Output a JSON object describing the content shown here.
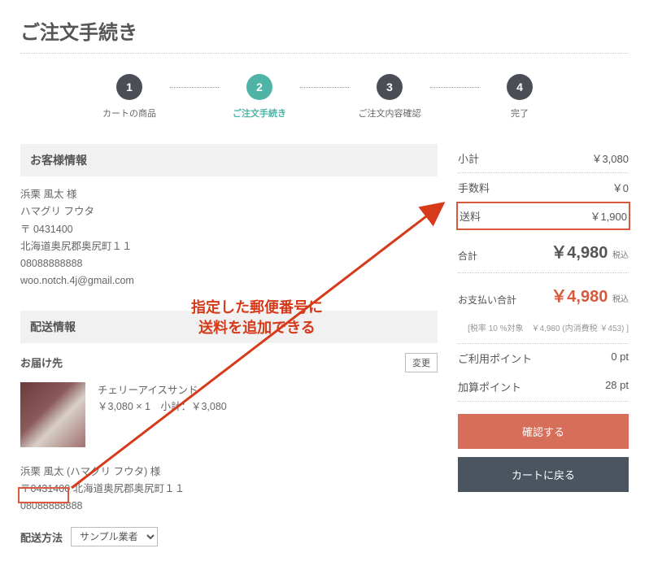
{
  "page": {
    "title": "ご注文手続き"
  },
  "steps": [
    {
      "num": "1",
      "label": "カートの商品"
    },
    {
      "num": "2",
      "label": "ご注文手続き"
    },
    {
      "num": "3",
      "label": "ご注文内容確認"
    },
    {
      "num": "4",
      "label": "完了"
    }
  ],
  "customer": {
    "header": "お客様情報",
    "name": "浜栗 風太 様",
    "kana": "ハマグリ フウタ",
    "postal": "〒 0431400",
    "address": "北海道奥尻郡奥尻町１１",
    "tel": "08088888888",
    "email": "woo.notch.4j@gmail.com"
  },
  "shipping": {
    "header": "配送情報",
    "subhead": "お届け先",
    "change_label": "変更",
    "product": {
      "name": "チェリーアイスサンド",
      "price_line": "￥3,080 × 1　小計：￥3,080"
    },
    "to": {
      "name": "浜栗 風太 (ハマグリ フウタ) 様",
      "postal_addr": "〒0431400 北海道奥尻郡奥尻町１１",
      "tel": "08088888888"
    },
    "method_label": "配送方法",
    "method_selected": "サンプル業者"
  },
  "summary": {
    "subtotal_label": "小計",
    "subtotal_value": "￥3,080",
    "fee_label": "手数料",
    "fee_value": "￥0",
    "ship_label": "送料",
    "ship_value": "￥1,900",
    "total_label": "合計",
    "total_value": "￥4,980",
    "suffix": "税込",
    "pay_label": "お支払い合計",
    "pay_value": "￥4,980",
    "tax_note": "[税率 10 %対象　￥4,980 (内消費税 ￥453) ]",
    "use_point_label": "ご利用ポイント",
    "use_point_value": "0 pt",
    "add_point_label": "加算ポイント",
    "add_point_value": "28 pt",
    "confirm_btn": "確認する",
    "back_btn": "カートに戻る"
  },
  "annotation": {
    "line1": "指定した郵便番号に",
    "line2": "送料を追加できる"
  }
}
